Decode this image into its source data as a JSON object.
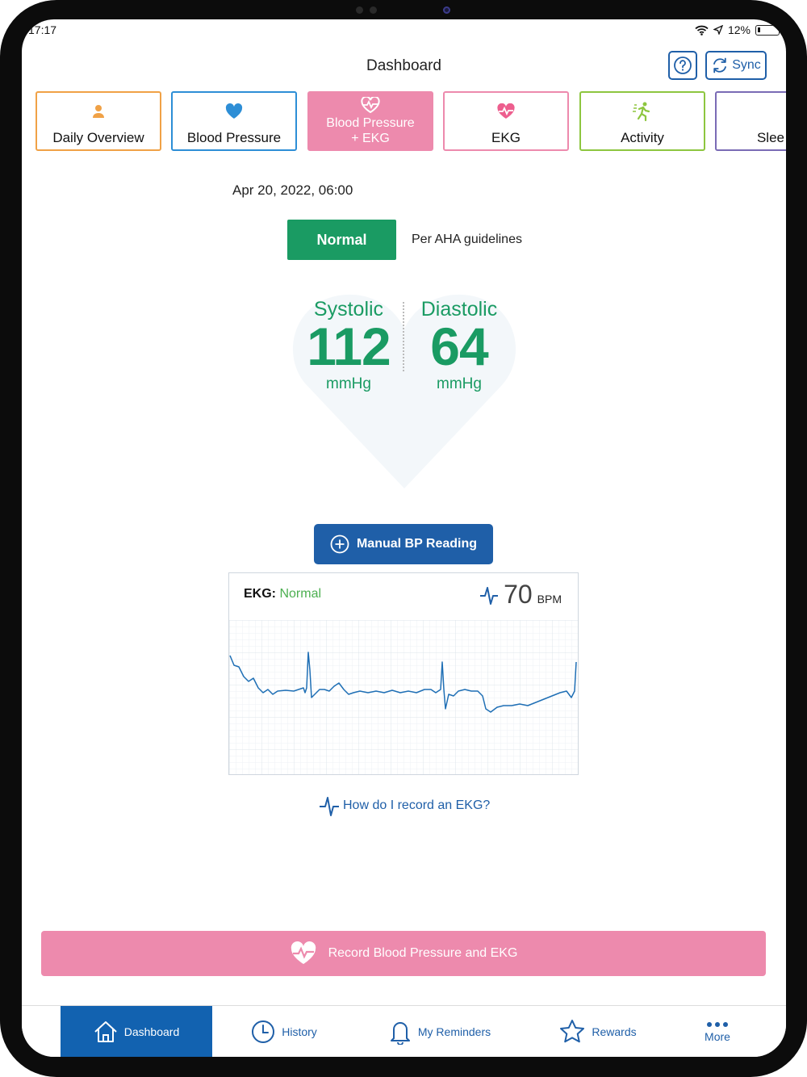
{
  "status_bar": {
    "time": "17:17",
    "battery": "12%"
  },
  "header": {
    "title": "Dashboard",
    "sync_label": "Sync",
    "help_icon": "question-icon"
  },
  "tabs": [
    {
      "label": "Daily Overview",
      "icon": "person-icon",
      "color": "#f0a146"
    },
    {
      "label": "Blood Pressure",
      "icon": "heart-icon",
      "color": "#2d8ed6"
    },
    {
      "label": "Blood Pressure\n+ EKG",
      "icon": "heart-pulse-icon",
      "color": "#ed8aad",
      "active": true
    },
    {
      "label": "EKG",
      "icon": "heart-pulse-icon",
      "color": "#ed8aad"
    },
    {
      "label": "Activity",
      "icon": "activity-icon",
      "color": "#8dc63f"
    },
    {
      "label": "Slee",
      "icon": "moon-icon",
      "color": "#7a6bb5"
    }
  ],
  "reading": {
    "datetime": "Apr 20, 2022, 06:00",
    "status": "Normal",
    "status_color": "#1a9b63",
    "guideline": "Per AHA guidelines",
    "systolic_label": "Systolic",
    "systolic_value": "112",
    "diastolic_label": "Diastolic",
    "diastolic_value": "64",
    "unit": "mmHg"
  },
  "manual_button": {
    "label": "Manual BP Reading"
  },
  "ekg": {
    "label": "EKG:",
    "status": "Normal",
    "bpm": "70",
    "bpm_unit": "BPM"
  },
  "howto": {
    "label": "How do I record an EKG?"
  },
  "record_button": {
    "label": "Record Blood Pressure and EKG"
  },
  "nav": {
    "dashboard": "Dashboard",
    "history": "History",
    "reminders": "My Reminders",
    "rewards": "Rewards",
    "more": "More"
  }
}
